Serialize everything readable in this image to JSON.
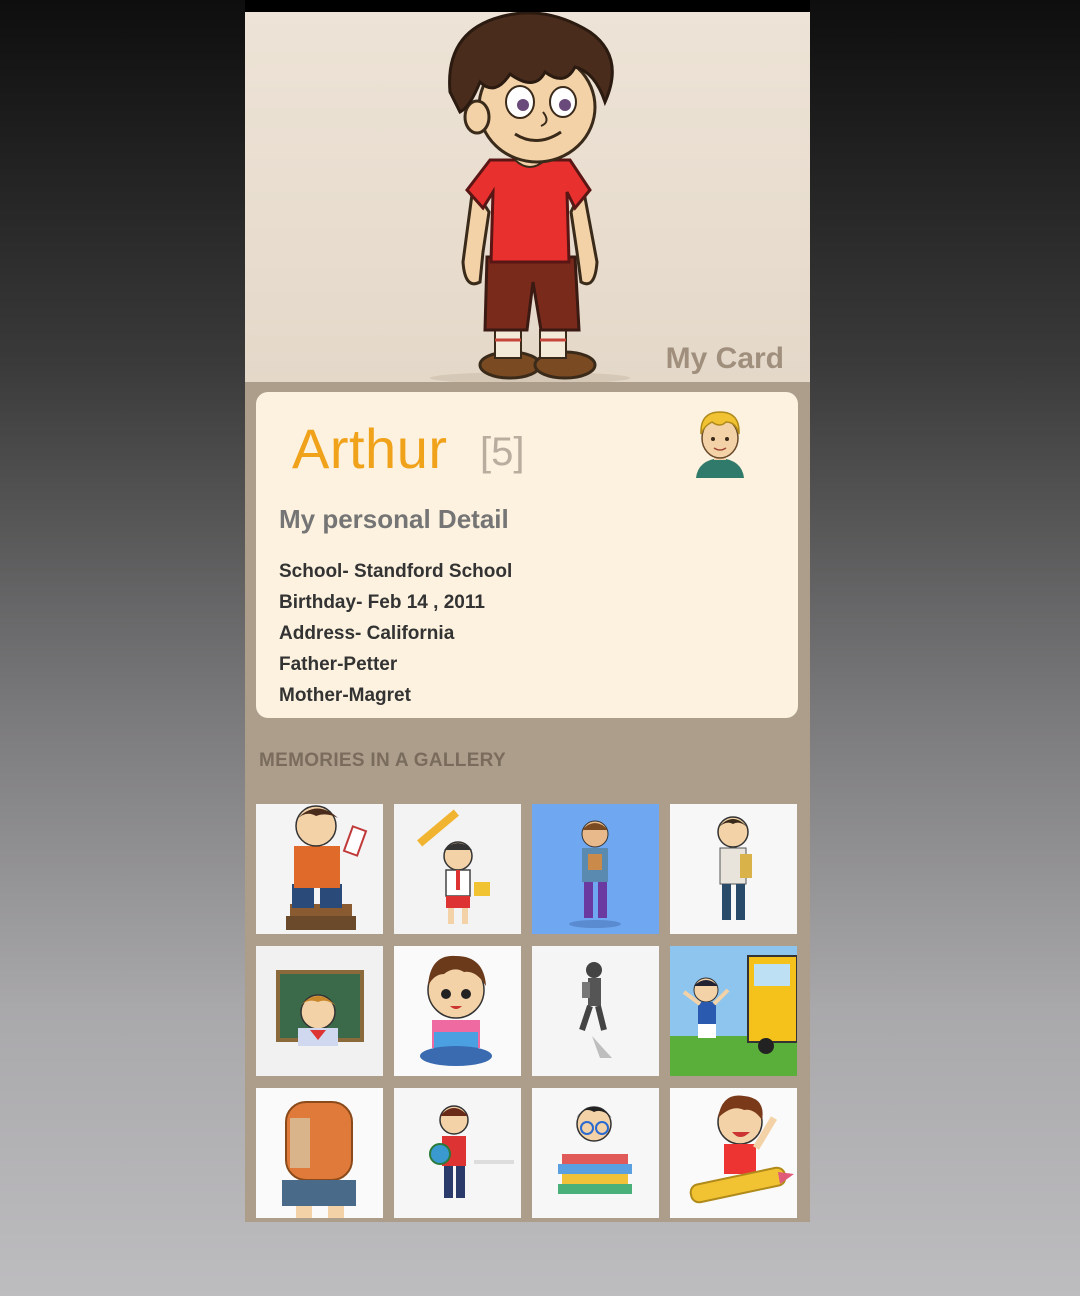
{
  "header": {
    "title": "My Card"
  },
  "profile": {
    "name": "Arthur",
    "age": "[5]",
    "section_title": "My personal Detail",
    "details": [
      "School- Standford School",
      "Birthday- Feb 14 , 2011",
      "Address- California",
      "Father-Petter",
      "Mother-Magret"
    ]
  },
  "gallery": {
    "title": "MEMORIES IN A GALLERY",
    "images": [
      "boy-reading-books-illustration",
      "boy-with-pencil-illustration",
      "boy-with-backpack-blue-bg",
      "boy-with-school-bag",
      "boy-at-chalkboard",
      "boy-reading-book",
      "child-walking-silhouette",
      "kids-running-to-school-bus",
      "child-with-orange-backpack",
      "boy-with-globe",
      "boy-with-glasses-books",
      "boy-riding-pencil"
    ]
  },
  "colors": {
    "accent": "#f0a21a",
    "card_bg": "#fcf2df",
    "panel_bg": "#ad9e8c",
    "hero_bg": "#ede3d6"
  }
}
